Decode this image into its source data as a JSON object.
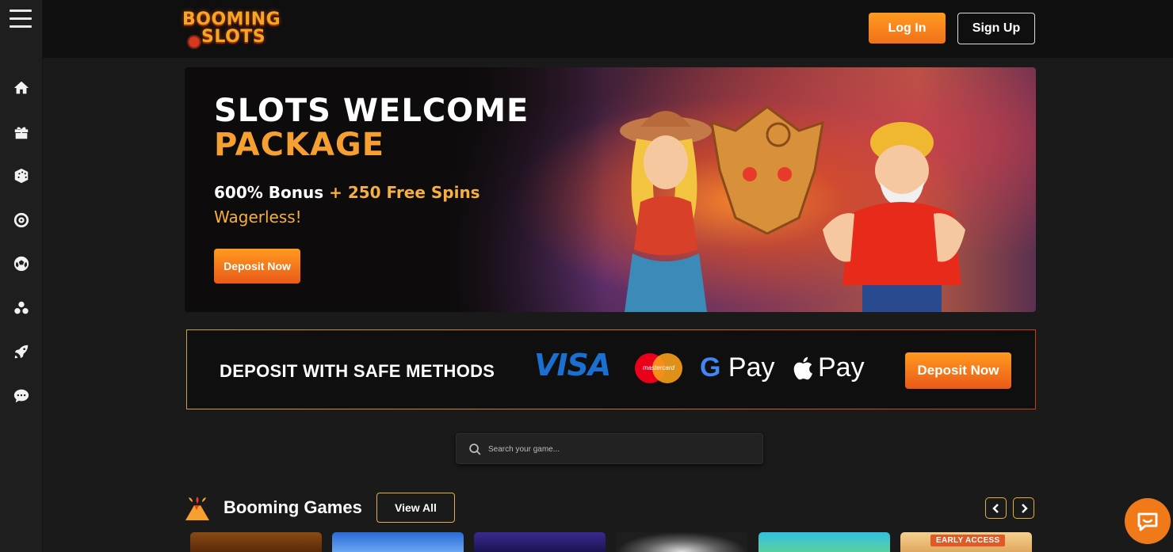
{
  "brand": {
    "logo_line1": "BOOMING",
    "logo_line2": "SLOTS"
  },
  "header": {
    "login_label": "Log In",
    "signup_label": "Sign Up"
  },
  "sidebar": {
    "items": [
      {
        "icon": "home-icon"
      },
      {
        "icon": "gift-icon"
      },
      {
        "icon": "dice-icon"
      },
      {
        "icon": "roulette-icon"
      },
      {
        "icon": "soccer-ball-icon"
      },
      {
        "icon": "poker-chips-icon"
      },
      {
        "icon": "rocket-icon"
      },
      {
        "icon": "chat-bubble-icon"
      }
    ]
  },
  "hero": {
    "title_line1": "SLOTS WELCOME",
    "title_line2": "PACKAGE",
    "bonus_part1": "600% Bonus",
    "bonus_part2": "+ 250 Free Spins",
    "wager": "Wagerless!",
    "cta_label": "Deposit Now"
  },
  "deposit": {
    "text": "DEPOSIT WITH SAFE METHODS",
    "visa_label": "VISA",
    "mastercard_label": "mastercard",
    "gpay_g": "G",
    "gpay_label": "Pay",
    "applepay_label": "Pay",
    "cta_label": "Deposit Now"
  },
  "search": {
    "placeholder": "Search your game..."
  },
  "games": {
    "title": "Booming Games",
    "view_all_label": "View All",
    "early_access_label": "EARLY ACCESS",
    "thumbnails": [
      {
        "color": "#7a3a10"
      },
      {
        "color": "#3a80e0"
      },
      {
        "color": "#2a1e70"
      },
      {
        "color": "#2a2a2a"
      },
      {
        "color": "#40a0c0"
      },
      {
        "color": "#e8c080"
      }
    ]
  },
  "colors": {
    "accent": "#f07a1a",
    "gold": "#f5a030",
    "background": "#1a1a1a"
  }
}
